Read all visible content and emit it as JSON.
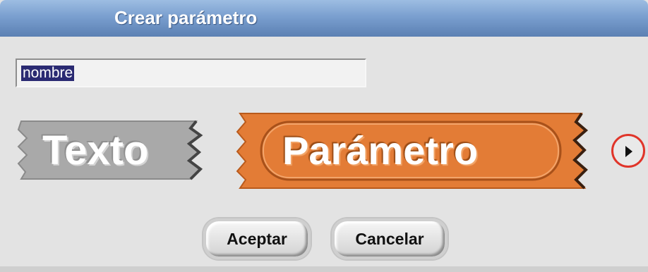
{
  "dialog": {
    "title": "Crear parámetro",
    "input": {
      "value": "nombre",
      "selected": true
    },
    "blocks": [
      {
        "label": "Texto",
        "color": "#a6a6a6"
      },
      {
        "label": "Parámetro",
        "color": "#e37c36"
      }
    ],
    "next_icon": "triangle-right-icon",
    "buttons": {
      "ok": "Aceptar",
      "cancel": "Cancelar"
    },
    "colors": {
      "titlebar": "#7a9fcf",
      "highlight_ring": "#e0352a",
      "selection": "#2a2a72"
    }
  }
}
